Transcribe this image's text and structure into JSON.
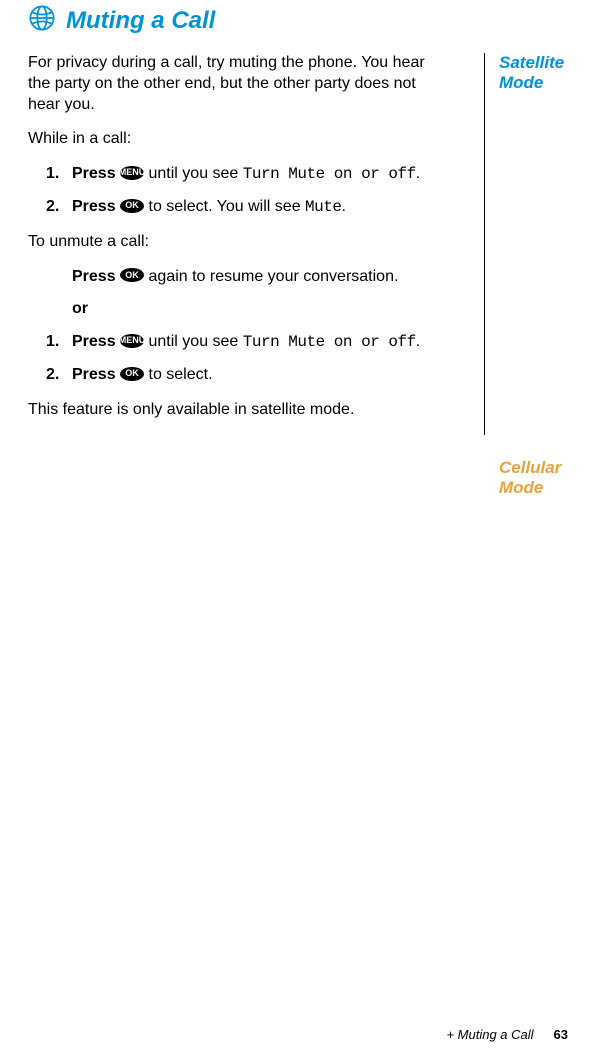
{
  "heading": {
    "icon_name": "globe",
    "title": "Muting a Call"
  },
  "side": {
    "satellite_label_1": "Satellite",
    "satellite_label_2": "Mode",
    "cellular_label_1": "Cellular",
    "cellular_label_2": "Mode"
  },
  "body": {
    "intro": "For privacy during a call, try muting the phone. You hear the party on the other end, but the other party does not hear you.",
    "while_in_call": "While in a call:",
    "step1_prefix": "Press ",
    "step1_suffix": " until you see ",
    "step1_display": "Turn Mute on or off",
    "step1_end": ".",
    "step2_prefix": "Press ",
    "step2_mid": " to select. You will see ",
    "step2_display": "Mute",
    "step2_end": ".",
    "unmute_intro": "To unmute a call:",
    "unmute_press_prefix": "Press ",
    "unmute_press_suffix": " again to resume your conversation.",
    "or_text": "or",
    "alt_step1_prefix": "Press ",
    "alt_step1_suffix": " until you see ",
    "alt_step1_display": "Turn Mute on or off",
    "alt_step1_end": ".",
    "alt_step2_prefix": "Press ",
    "alt_step2_suffix": " to select.",
    "cellular_note": "This feature is only available in satellite mode."
  },
  "keys": {
    "menu": "MENU",
    "ok": "OK"
  },
  "steps": {
    "n1": "1.",
    "n2": "2."
  },
  "footer": {
    "section": "+ Muting a Call",
    "page": "63"
  }
}
